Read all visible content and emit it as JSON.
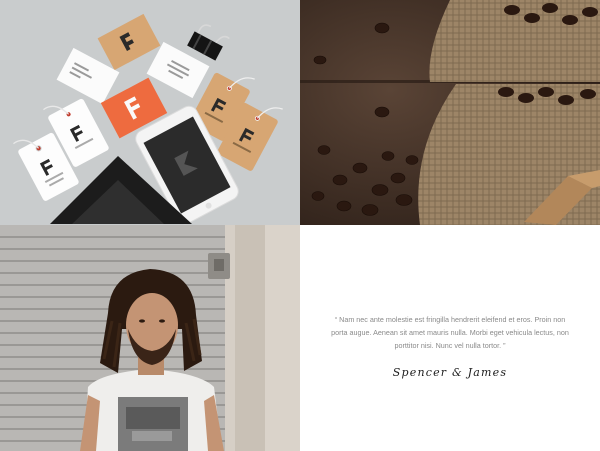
{
  "gallery": {
    "tiles": [
      {
        "kind": "image",
        "subject": "branding-mockup"
      },
      {
        "kind": "image",
        "subject": "coffee-sack"
      },
      {
        "kind": "image",
        "subject": "portrait"
      },
      {
        "kind": "testimonial"
      }
    ]
  },
  "testimonial": {
    "quote": "“ Nam nec ante molestie est fringilla hendrerit eleifend et eros. Proin non porta augue. Aenean sit amet mauris nulla. Morbi eget vehicula lectus, non porttitor nisi. Nunc vel nulla tortor. ”",
    "author": "Spencer & James"
  },
  "colors": {
    "mockup_bg": "#c9cccd",
    "accent_orange": "#ee6b3f",
    "kraft": "#d7a673",
    "coffee_dark": "#3a2a22",
    "burlap": "#9d8567",
    "text_gray": "#8a8a8a",
    "signature": "#1c1c1c"
  }
}
